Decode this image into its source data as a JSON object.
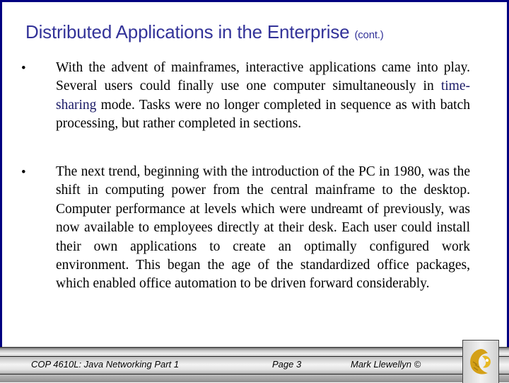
{
  "slide": {
    "title": "Distributed Applications in the Enterprise",
    "title_suffix": "(cont.)",
    "bullet_glyph": "•",
    "bullets": [
      {
        "before": "With the advent of mainframes, interactive applications came into play.  Several users could finally use one computer simultaneously in ",
        "highlight": "time-sharing",
        "after": " mode.  Tasks were no longer completed in sequence as with batch processing, but rather completed in sections."
      },
      {
        "text": "The next trend, beginning with the introduction of the PC in 1980, was the shift in computing power from the central mainframe to the desktop.  Computer performance at levels which were undreamt of previously, was now available to employees directly at their desk.  Each user could install their own applications to create an optimally configured work environment.  This began the age of the standardized office packages, which enabled office automation to be driven forward considerably."
      }
    ]
  },
  "footer": {
    "course": "COP 4610L: Java Networking Part 1",
    "page": "Page 3",
    "author": "Mark Llewellyn ©",
    "logo_icon": "pegasus-logo-icon"
  },
  "colors": {
    "frame": "#000080",
    "title": "#333399",
    "highlight": "#1a1a66",
    "logo_gold": "#d4a017"
  }
}
